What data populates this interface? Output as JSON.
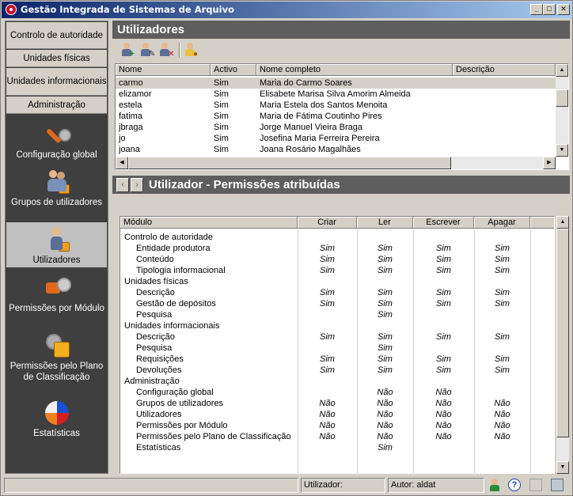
{
  "window": {
    "title": "Gestão Integrada de Sistemas de Arquivo",
    "min": "_",
    "max": "□",
    "close": "✕"
  },
  "nav": {
    "sections": [
      "Controlo de autoridade",
      "Unidades físicas",
      "Unidades informacionais",
      "Administração"
    ],
    "items": [
      {
        "label": "Configuração global",
        "icon": "wrench-icon"
      },
      {
        "label": "Grupos de utilizadores",
        "icon": "user-group-icon"
      },
      {
        "label": "Utilizadores",
        "icon": "user-lock-icon",
        "active": true
      },
      {
        "label": "Permissões por Módulo",
        "icon": "module-permission-icon"
      },
      {
        "label": "Permissões pelo Plano de Classificação",
        "icon": "plan-permission-icon"
      },
      {
        "label": "Estatísticas",
        "icon": "pie-chart-icon"
      }
    ]
  },
  "users_panel": {
    "title": "Utilizadores",
    "columns": [
      "Nome",
      "Activo",
      "Nome completo",
      "Descrição"
    ],
    "rows": [
      {
        "nome": "carmo",
        "activo": "Sim",
        "completo": "Maria do Carmo Soares",
        "descricao": ""
      },
      {
        "nome": "elizamor",
        "activo": "Sim",
        "completo": "Elisabete Marisa Silva Amorim Almeida",
        "descricao": ""
      },
      {
        "nome": "estela",
        "activo": "Sim",
        "completo": "Maria Estela dos Santos Menoita",
        "descricao": ""
      },
      {
        "nome": "fatima",
        "activo": "Sim",
        "completo": "Maria de Fátima Coutinho Pires",
        "descricao": ""
      },
      {
        "nome": "jbraga",
        "activo": "Sim",
        "completo": "Jorge Manuel Vieira Braga",
        "descricao": ""
      },
      {
        "nome": "jo",
        "activo": "Sim",
        "completo": "Josefina Maria Ferreira Pereira",
        "descricao": ""
      },
      {
        "nome": "joana",
        "activo": "Sim",
        "completo": "Joana Rosário Magalhães",
        "descricao": ""
      }
    ]
  },
  "perm_panel": {
    "title": "Utilizador - Permissões atribuídas",
    "prev": "‹",
    "next": "›",
    "columns": [
      "Módulo",
      "Criar",
      "Ler",
      "Escrever",
      "Apagar"
    ],
    "rows": [
      {
        "m": "Controlo de autoridade",
        "lvl": 0,
        "c": "",
        "l": "",
        "e": "",
        "a": ""
      },
      {
        "m": "Entidade produtora",
        "lvl": 1,
        "c": "Sim",
        "l": "Sim",
        "e": "Sim",
        "a": "Sim"
      },
      {
        "m": "Conteúdo",
        "lvl": 1,
        "c": "Sim",
        "l": "Sim",
        "e": "Sim",
        "a": "Sim"
      },
      {
        "m": "Tipologia informacional",
        "lvl": 1,
        "c": "Sim",
        "l": "Sim",
        "e": "Sim",
        "a": "Sim"
      },
      {
        "m": "Unidades físicas",
        "lvl": 0,
        "c": "",
        "l": "",
        "e": "",
        "a": ""
      },
      {
        "m": "Descrição",
        "lvl": 1,
        "c": "Sim",
        "l": "Sim",
        "e": "Sim",
        "a": "Sim"
      },
      {
        "m": "Gestão de depósitos",
        "lvl": 1,
        "c": "Sim",
        "l": "Sim",
        "e": "Sim",
        "a": "Sim"
      },
      {
        "m": "Pesquisa",
        "lvl": 1,
        "c": "",
        "l": "Sim",
        "e": "",
        "a": ""
      },
      {
        "m": "Unidades informacionais",
        "lvl": 0,
        "c": "",
        "l": "",
        "e": "",
        "a": ""
      },
      {
        "m": "Descrição",
        "lvl": 1,
        "c": "Sim",
        "l": "Sim",
        "e": "Sim",
        "a": "Sim"
      },
      {
        "m": "Pesquisa",
        "lvl": 1,
        "c": "",
        "l": "Sim",
        "e": "",
        "a": ""
      },
      {
        "m": "Requisições",
        "lvl": 1,
        "c": "Sim",
        "l": "Sim",
        "e": "Sim",
        "a": "Sim"
      },
      {
        "m": "Devoluções",
        "lvl": 1,
        "c": "Sim",
        "l": "Sim",
        "e": "Sim",
        "a": "Sim"
      },
      {
        "m": "Administração",
        "lvl": 0,
        "c": "",
        "l": "",
        "e": "",
        "a": ""
      },
      {
        "m": "Configuração global",
        "lvl": 1,
        "c": "",
        "l": "Não",
        "e": "Não",
        "a": ""
      },
      {
        "m": "Grupos de utilizadores",
        "lvl": 1,
        "c": "Não",
        "l": "Não",
        "e": "Não",
        "a": "Não"
      },
      {
        "m": "Utilizadores",
        "lvl": 1,
        "c": "Não",
        "l": "Não",
        "e": "Não",
        "a": "Não"
      },
      {
        "m": "Permissões por Módulo",
        "lvl": 1,
        "c": "Não",
        "l": "Não",
        "e": "Não",
        "a": "Não"
      },
      {
        "m": "Permissões pelo Plano de Classificação",
        "lvl": 1,
        "c": "Não",
        "l": "Não",
        "e": "Não",
        "a": "Não"
      },
      {
        "m": "Estatísticas",
        "lvl": 1,
        "c": "",
        "l": "Sim",
        "e": "",
        "a": ""
      }
    ]
  },
  "status": {
    "user_label": "Utilizador:",
    "author": "Autor: aldat",
    "help": "?"
  },
  "colors": {
    "header_bg": "#5e5e5e",
    "nav_bg": "#3f3f3f",
    "title_start": "#0a246a",
    "title_end": "#a6caf0"
  }
}
